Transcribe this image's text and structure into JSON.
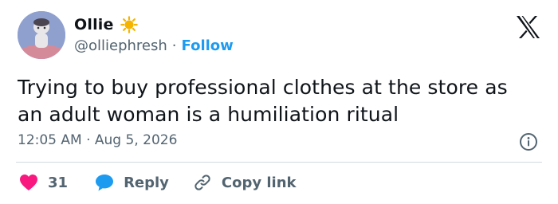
{
  "author": {
    "display_name": "Ollie",
    "handle": "@olliephresh",
    "separator": "·",
    "follow_label": "Follow",
    "avatar_icon": "avatar-illustration",
    "badge_icon": "verified-star-badge-icon"
  },
  "platform_icon": "x-logo-icon",
  "tweet": {
    "text": "Trying to buy professional clothes at the store as an adult woman is a humiliation ritual",
    "timestamp": "12:05 AM · Aug 5, 2026"
  },
  "actions": {
    "like_count": "31",
    "reply_label": "Reply",
    "copy_link_label": "Copy link"
  },
  "colors": {
    "like": "#f91880",
    "reply": "#1d9bf0",
    "follow": "#1d9bf0",
    "muted": "#536471",
    "badge": "#f5b400"
  }
}
